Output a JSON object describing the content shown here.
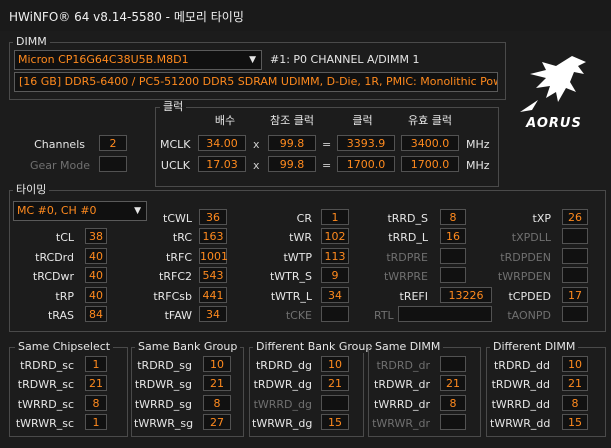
{
  "window": {
    "title": "HWiNFO® 64 v8.14-5580 - 메모리 타이밍"
  },
  "dimm": {
    "legend": "DIMM",
    "module_select": "Micron CP16G64C38U5B.M8D1",
    "slot_label": "#1: P0 CHANNEL A/DIMM 1",
    "description": "[16 GB] DDR5-6400 / PC5-51200 DDR5 SDRAM UDIMM, D-Die, 1R, PMIC: Monolithic Power Systems",
    "channels_label": "Channels",
    "channels_value": "2",
    "gear_mode_label": "Gear Mode",
    "gear_mode_value": ""
  },
  "clock": {
    "legend": "클럭",
    "headers": {
      "multiplier": "배수",
      "ref_clock": "참조 클럭",
      "clock": "클럭",
      "effective": "유효 클럭"
    },
    "mclk": {
      "label": "MCLK",
      "mult": "34.00",
      "x": "x",
      "ref": "99.8",
      "eq": "=",
      "clock": "3393.9",
      "eff": "3400.0",
      "unit": "MHz"
    },
    "uclk": {
      "label": "UCLK",
      "mult": "17.03",
      "x": "x",
      "ref": "99.8",
      "eq": "=",
      "clock": "1700.0",
      "eff": "1700.0",
      "unit": "MHz"
    }
  },
  "brand": {
    "logo_text": "AORUS"
  },
  "timing": {
    "legend": "타이밍",
    "channel_select": "MC #0, CH #0",
    "col1": [
      {
        "label": "tCL",
        "value": "38"
      },
      {
        "label": "tRCDrd",
        "value": "40"
      },
      {
        "label": "tRCDwr",
        "value": "40"
      },
      {
        "label": "tRP",
        "value": "40"
      },
      {
        "label": "tRAS",
        "value": "84"
      }
    ],
    "col2": [
      {
        "label": "tCWL",
        "value": "36"
      },
      {
        "label": "tRC",
        "value": "163"
      },
      {
        "label": "tRFC",
        "value": "1001"
      },
      {
        "label": "tRFC2",
        "value": "543"
      },
      {
        "label": "tRFCsb",
        "value": "441"
      },
      {
        "label": "tFAW",
        "value": "34"
      }
    ],
    "col3": [
      {
        "label": "CR",
        "value": "1"
      },
      {
        "label": "tWR",
        "value": "102"
      },
      {
        "label": "tWTP",
        "value": "113"
      },
      {
        "label": "tWTR_S",
        "value": "9"
      },
      {
        "label": "tWTR_L",
        "value": "34"
      },
      {
        "label": "tCKE",
        "value": ""
      }
    ],
    "col4": [
      {
        "label": "tRRD_S",
        "value": "8"
      },
      {
        "label": "tRRD_L",
        "value": "16"
      },
      {
        "label": "tRDPRE",
        "value": ""
      },
      {
        "label": "tWRPRE",
        "value": ""
      },
      {
        "label": "tREFI",
        "value": "13226"
      }
    ],
    "rtl_label": "RTL",
    "col5": [
      {
        "label": "tXP",
        "value": "26"
      },
      {
        "label": "tXPDLL",
        "value": ""
      },
      {
        "label": "tRDPDEN",
        "value": ""
      },
      {
        "label": "tWRPDEN",
        "value": ""
      },
      {
        "label": "tCPDED",
        "value": "17"
      },
      {
        "label": "tAONPD",
        "value": ""
      }
    ]
  },
  "groups": [
    {
      "legend": "Same Chipselect",
      "rows": [
        {
          "label": "tRDRD_sc",
          "value": "1"
        },
        {
          "label": "tRDWR_sc",
          "value": "21"
        },
        {
          "label": "tWRRD_sc",
          "value": "8"
        },
        {
          "label": "tWRWR_sc",
          "value": "1"
        }
      ]
    },
    {
      "legend": "Same Bank Group",
      "rows": [
        {
          "label": "tRDRD_sg",
          "value": "10"
        },
        {
          "label": "tRDWR_sg",
          "value": "21"
        },
        {
          "label": "tWRRD_sg",
          "value": "8"
        },
        {
          "label": "tWRWR_sg",
          "value": "27"
        }
      ]
    },
    {
      "legend": "Different Bank Group",
      "rows": [
        {
          "label": "tRDRD_dg",
          "value": "10"
        },
        {
          "label": "tRDWR_dg",
          "value": "21"
        },
        {
          "label": "tWRRD_dg",
          "value": ""
        },
        {
          "label": "tWRWR_dg",
          "value": "15"
        }
      ]
    },
    {
      "legend": "Same DIMM",
      "rows": [
        {
          "label": "tRDRD_dr",
          "value": ""
        },
        {
          "label": "tRDWR_dr",
          "value": "21"
        },
        {
          "label": "tWRRD_dr",
          "value": "8"
        },
        {
          "label": "tWRWR_dr",
          "value": ""
        }
      ]
    },
    {
      "legend": "Different DIMM",
      "rows": [
        {
          "label": "tRDRD_dd",
          "value": "10"
        },
        {
          "label": "tRDWR_dd",
          "value": "21"
        },
        {
          "label": "tWRRD_dd",
          "value": "8"
        },
        {
          "label": "tWRWR_dd",
          "value": "15"
        }
      ]
    }
  ],
  "colors": {
    "accent_value": "#ff8a1e",
    "background": "#1c1c1c",
    "border": "#4a4a4a"
  }
}
